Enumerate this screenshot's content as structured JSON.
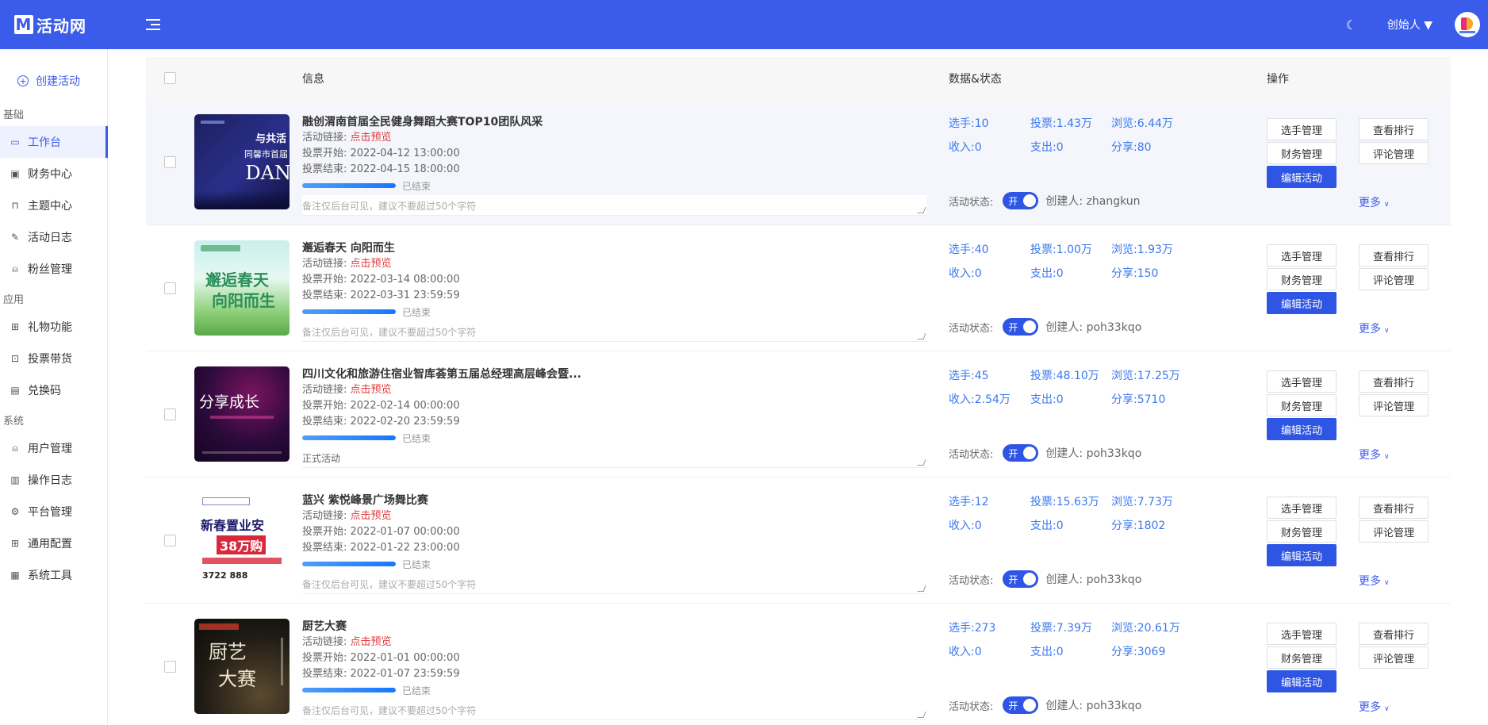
{
  "app": {
    "logo_mark": "M",
    "name": "活动网"
  },
  "header": {
    "user_role": "创始人 ▼"
  },
  "sidebar": {
    "create_label": "创建活动",
    "sections": [
      {
        "title": "基础",
        "items": [
          {
            "label": "工作台",
            "icon": "monitor-icon",
            "active": true
          },
          {
            "label": "财务中心",
            "icon": "wallet-icon"
          },
          {
            "label": "主题中心",
            "icon": "sofa-icon"
          },
          {
            "label": "活动日志",
            "icon": "edit-icon"
          },
          {
            "label": "粉丝管理",
            "icon": "user-icon"
          }
        ]
      },
      {
        "title": "应用",
        "items": [
          {
            "label": "礼物功能",
            "icon": "gift-icon"
          },
          {
            "label": "投票带货",
            "icon": "shop-icon"
          },
          {
            "label": "兑换码",
            "icon": "ticket-icon"
          }
        ]
      },
      {
        "title": "系统",
        "items": [
          {
            "label": "用户管理",
            "icon": "user-icon"
          },
          {
            "label": "操作日志",
            "icon": "log-icon"
          },
          {
            "label": "平台管理",
            "icon": "gear-icon"
          },
          {
            "label": "通用配置",
            "icon": "grid-icon"
          },
          {
            "label": "系统工具",
            "icon": "table-icon"
          }
        ]
      }
    ]
  },
  "table": {
    "headers": {
      "info": "信息",
      "data": "数据&状态",
      "ops": "操作"
    },
    "labels": {
      "link_prefix": "活动链接: ",
      "link_text": "点击预览",
      "vote_start": "投票开始: ",
      "vote_end": "投票结束: ",
      "status": "活动状态:",
      "toggle_on": "开",
      "creator_prefix": "创建人: ",
      "btn_players": "选手管理",
      "btn_rank": "查看排行",
      "btn_finance": "财务管理",
      "btn_comments": "评论管理",
      "btn_edit": "编辑活动",
      "btn_more": "更多"
    },
    "rows": [
      {
        "title": "融创渭南首届全民健身舞蹈大赛TOP10团队风采",
        "start": "2022-04-12 13:00:00",
        "end": "2022-04-15 18:00:00",
        "state": "已结束",
        "progress": 100,
        "remark": "备注仅后台可见，建议不要超过50个字符",
        "remark_filled": false,
        "players": "选手:10",
        "votes": "投票:1.43万",
        "views": "浏览:6.44万",
        "income": "收入:0",
        "expense": "支出:0",
        "shares": "分享:80",
        "creator": "zhangkun",
        "thumb": "dance"
      },
      {
        "title": "邂逅春天 向阳而生",
        "start": "2022-03-14 08:00:00",
        "end": "2022-03-31 23:59:59",
        "state": "已结束",
        "progress": 100,
        "remark": "备注仅后台可见，建议不要超过50个字符",
        "remark_filled": false,
        "players": "选手:40",
        "votes": "投票:1.00万",
        "views": "浏览:1.93万",
        "income": "收入:0",
        "expense": "支出:0",
        "shares": "分享:150",
        "creator": "poh33kqo",
        "thumb": "spring"
      },
      {
        "title": "四川文化和旅游住宿业智库荟第五届总经理高层峰会暨...",
        "start": "2022-02-14 00:00:00",
        "end": "2022-02-20 23:59:59",
        "state": "已结束",
        "progress": 100,
        "remark": "正式活动",
        "remark_filled": true,
        "players": "选手:45",
        "votes": "投票:48.10万",
        "views": "浏览:17.25万",
        "income": "收入:2.54万",
        "expense": "支出:0",
        "shares": "分享:5710",
        "creator": "poh33kqo",
        "thumb": "summit"
      },
      {
        "title": "蓝兴 紫悦峰景广场舞比赛",
        "start": "2022-01-07 00:00:00",
        "end": "2022-01-22 23:00:00",
        "state": "已结束",
        "progress": 100,
        "remark": "备注仅后台可见，建议不要超过50个字符",
        "remark_filled": false,
        "players": "选手:12",
        "votes": "投票:15.63万",
        "views": "浏览:7.73万",
        "income": "收入:0",
        "expense": "支出:0",
        "shares": "分享:1802",
        "creator": "poh33kqo",
        "thumb": "estate"
      },
      {
        "title": "厨艺大赛",
        "start": "2022-01-01 00:00:00",
        "end": "2022-01-07 23:59:59",
        "state": "已结束",
        "progress": 100,
        "remark": "备注仅后台可见，建议不要超过50个字符",
        "remark_filled": false,
        "players": "选手:273",
        "votes": "投票:7.39万",
        "views": "浏览:20.61万",
        "income": "收入:0",
        "expense": "支出:0",
        "shares": "分享:3069",
        "creator": "poh33kqo",
        "thumb": "cook"
      }
    ]
  },
  "thumb_texts": {
    "dance": {
      "line1": "与共活",
      "line2": "同馨市首届",
      "line3": "DAN"
    },
    "spring": {
      "line1": "邂逅春天",
      "line2": "向阳而生"
    },
    "summit": {
      "line1": "分享成长"
    },
    "estate": {
      "line1": "新春置业安",
      "line2": "38万购",
      "line3": "3722 888"
    },
    "cook": {
      "line1": "厨艺",
      "line2": "大赛"
    }
  },
  "colors": {
    "brand": "#3b5bea",
    "link": "#e4393c",
    "stat": "#3b78f0",
    "primary_btn": "#2f55e4"
  }
}
